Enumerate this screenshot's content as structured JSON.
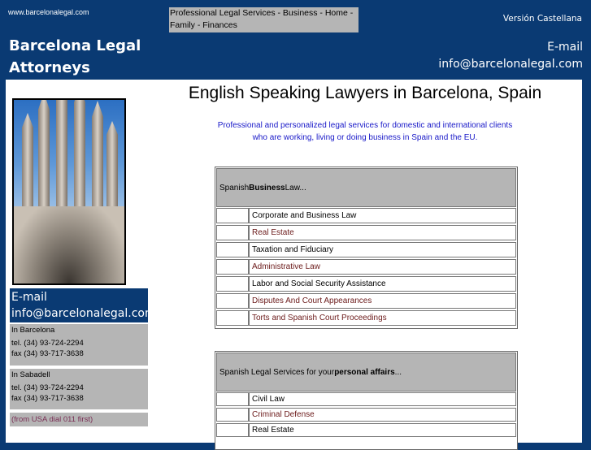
{
  "header": {
    "url_text": "www.barcelonalegal.com",
    "nav_text": "Professional Legal Services - Business - Home - Family - Finances",
    "language_link": "Versión Castellana",
    "title_line1": "Barcelona Legal",
    "title_line2": "Attorneys",
    "email_label": "E-mail",
    "email_address": "info@barcelonalegal.com"
  },
  "sidebar": {
    "photo_alt": "Sagrada Familia",
    "email_label": "E-mail",
    "email_address": "info@barcelonalegal.com",
    "offices": [
      {
        "city": "In Barcelona",
        "tel": "tel. (34) 93-724-2294",
        "fax": "fax (34) 93-717-3638"
      },
      {
        "city": "In Sabadell",
        "tel": "tel. (34) 93-724-2294",
        "fax": "fax (34) 93-717-3638"
      }
    ],
    "usa_note": "(from USA dial 011 first)"
  },
  "main": {
    "title": "English Speaking Lawyers in Barcelona, Spain",
    "intro_line1": "Professional and personalized legal services for domestic and international clients",
    "intro_line2": "who are working, living or doing business in Spain and the EU.",
    "business_table": {
      "heading_pre": "Spanish ",
      "heading_bold": "Business",
      "heading_post": " Law...",
      "items": [
        "Corporate and Business Law",
        "Real Estate",
        "Taxation and Fiduciary",
        "Administrative Law",
        "Labor and Social Security Assistance",
        "Disputes And Court Appearances",
        "Torts and Spanish Court Proceedings"
      ]
    },
    "personal_table": {
      "heading_pre": "Spanish Legal Services for your ",
      "heading_bold": "personal affairs",
      "heading_post": "...",
      "items": [
        "Civil Law",
        "Criminal Defense",
        "Real Estate"
      ]
    }
  },
  "colors": {
    "brand_navy": "#0a3a73",
    "panel_gray": "#b5b5b5",
    "link_maroon": "#6b1a1a",
    "intro_blue": "#1818c8"
  }
}
